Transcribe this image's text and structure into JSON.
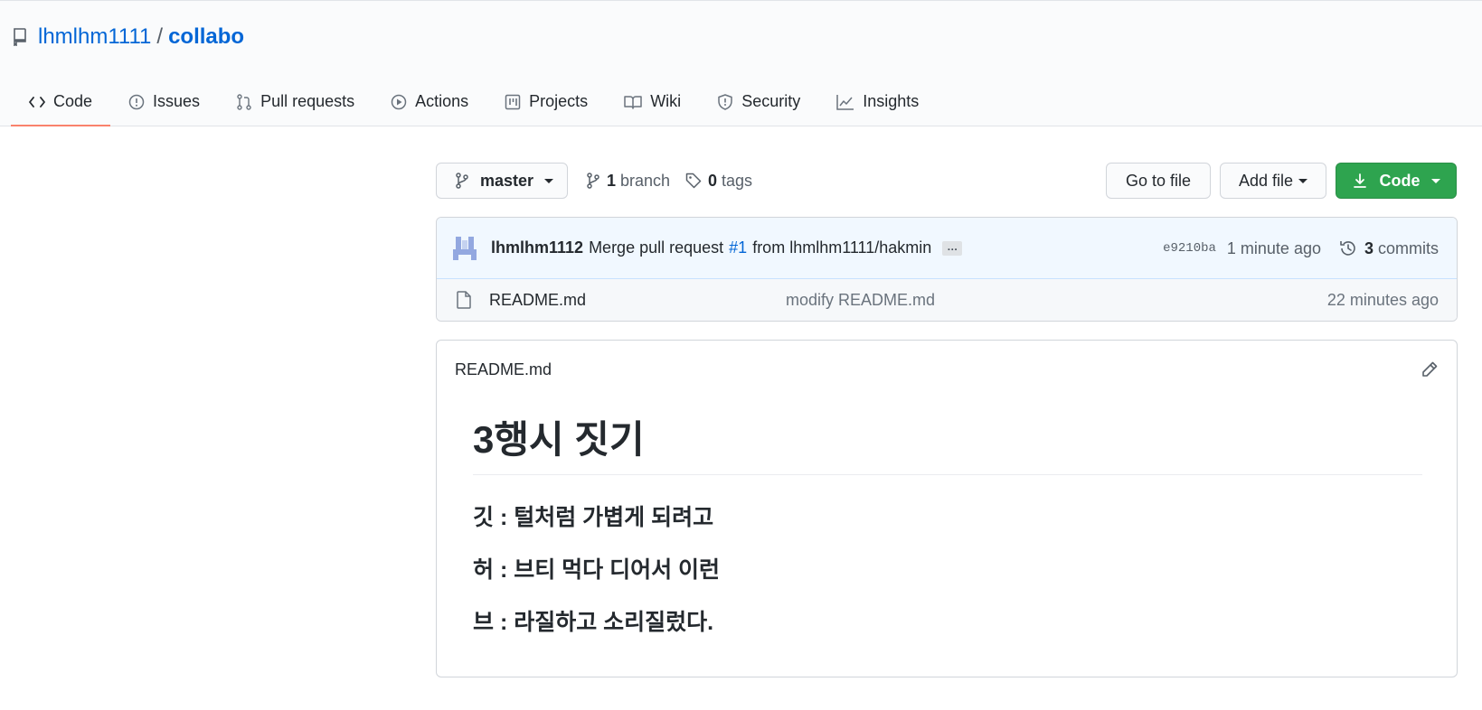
{
  "repo": {
    "owner": "lhmlhm1111",
    "separator": "/",
    "name": "collabo"
  },
  "tabs": [
    {
      "label": "Code",
      "icon": "code-icon"
    },
    {
      "label": "Issues",
      "icon": "issue-icon"
    },
    {
      "label": "Pull requests",
      "icon": "pull-request-icon"
    },
    {
      "label": "Actions",
      "icon": "play-icon"
    },
    {
      "label": "Projects",
      "icon": "project-icon"
    },
    {
      "label": "Wiki",
      "icon": "book-icon"
    },
    {
      "label": "Security",
      "icon": "shield-icon"
    },
    {
      "label": "Insights",
      "icon": "graph-icon"
    }
  ],
  "toolbar": {
    "branch": "master",
    "branch_count": "1",
    "branch_word": "branch",
    "tag_count": "0",
    "tag_word": "tags",
    "goto_label": "Go to file",
    "addfile_label": "Add file",
    "code_label": "Code"
  },
  "commit": {
    "author": "lhmlhm1112",
    "message_prefix": "Merge pull request",
    "pr_link": "#1",
    "message_suffix": "from lhmlhm1111/hakmin",
    "ellipsis": "…",
    "sha": "e9210ba",
    "time": "1 minute ago",
    "commit_count": "3",
    "commit_word": "commits"
  },
  "files": [
    {
      "name": "README.md",
      "message": "modify README.md",
      "time": "22 minutes ago"
    }
  ],
  "readme": {
    "filename": "README.md",
    "heading": "3행시 짓기",
    "lines": [
      "깃 : 털처럼 가볍게 되려고",
      "허 : 브티 먹다 디어서 이런",
      "브 : 라질하고 소리질렀다."
    ]
  },
  "colors": {
    "accent": "#0366d6",
    "primary_button": "#2ea44f",
    "active_tab_underline": "#f9826c"
  }
}
